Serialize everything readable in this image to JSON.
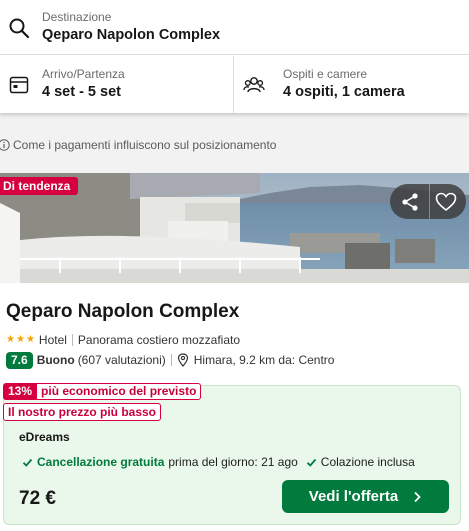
{
  "search": {
    "destination_label": "Destinazione",
    "destination_value": "Qeparo Napolon Complex",
    "dates_label": "Arrivo/Partenza",
    "dates_value": "4 set - 5 set",
    "guests_label": "Ospiti e camere",
    "guests_value": "4 ospiti, 1 camera"
  },
  "info_line": "Come i pagamenti influiscono sul posizionamento",
  "result": {
    "badge": "Di tendenza",
    "hotel_name": "Qeparo Napolon Complex",
    "star_count": 3,
    "category": "Hotel",
    "feature": "Panorama costiero mozzafiato",
    "rating_score": "7.6",
    "rating_word": "Buono",
    "rating_count": "(607 valutazioni)",
    "location": "Himara, 9.2 km da: Centro",
    "deal": {
      "percent": "13%",
      "percent_text": "più economico del previsto",
      "best_price": "Il nostro prezzo più basso",
      "provider": "eDreams",
      "free_cancel": "Cancellazione gratuita",
      "free_cancel_until": "prima del giorno: 21 ago",
      "breakfast": "Colazione inclusa",
      "price": "72 €",
      "cta": "Vedi l'offerta"
    }
  },
  "colors": {
    "accent_green": "#007a3d",
    "badge_red": "#d60040",
    "star": "#f0a500"
  },
  "icons": [
    "search-icon",
    "calendar-icon",
    "guests-icon",
    "info-icon",
    "share-icon",
    "heart-icon",
    "map-pin-icon",
    "check-icon",
    "chevron-right-icon"
  ]
}
